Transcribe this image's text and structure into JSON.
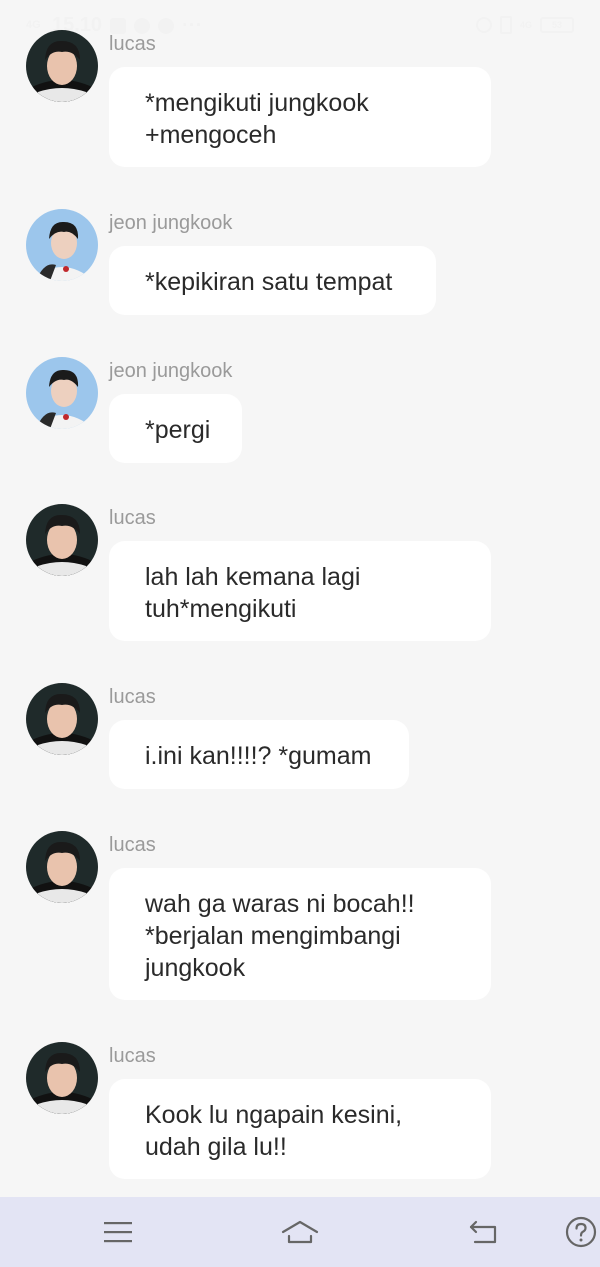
{
  "status_bar": {
    "signal_label": "4G",
    "time": "15.10",
    "overflow": "···",
    "network": "4G",
    "battery": "53"
  },
  "messages": [
    {
      "sender": "lucas",
      "avatar": "lucas",
      "text": "*mengikuti jungkook +mengoceh"
    },
    {
      "sender": "jeon jungkook",
      "avatar": "jungkook",
      "text": "*kepikiran satu tempat"
    },
    {
      "sender": "jeon jungkook",
      "avatar": "jungkook",
      "text": "*pergi"
    },
    {
      "sender": "lucas",
      "avatar": "lucas",
      "text": "lah lah kemana lagi tuh*mengikuti"
    },
    {
      "sender": "lucas",
      "avatar": "lucas",
      "text": "i.ini kan!!!!? *gumam"
    },
    {
      "sender": "lucas",
      "avatar": "lucas",
      "text": "wah ga waras ni bocah!! *berjalan mengimbangi jungkook"
    },
    {
      "sender": "lucas",
      "avatar": "lucas",
      "text": "Kook lu ngapain kesini, udah gila lu!!"
    }
  ],
  "nav": {
    "menu_icon": "hamburger-menu-icon",
    "home_icon": "home-icon",
    "back_icon": "back-icon",
    "help_icon": "help-icon"
  },
  "colors": {
    "background": "#f6f6f6",
    "bubble": "#ffffff",
    "sender_text": "#9a9a9a",
    "message_text": "#2a2a2a",
    "navbar": "#e3e4f4",
    "nav_icon": "#666666"
  }
}
